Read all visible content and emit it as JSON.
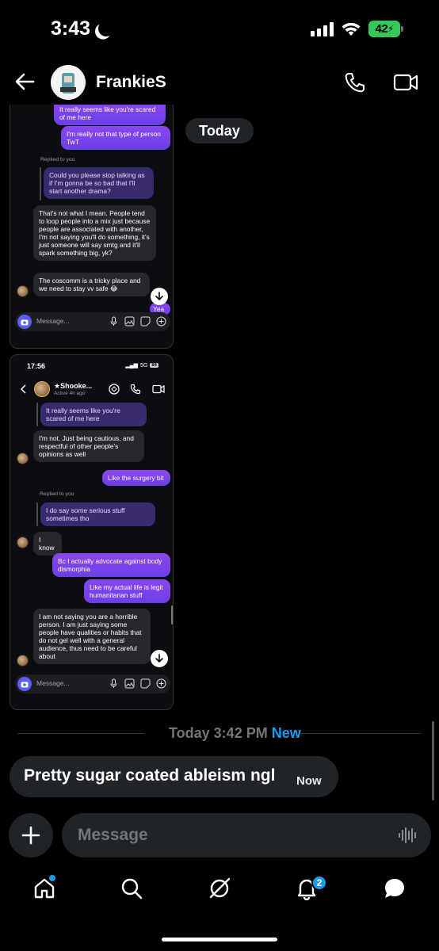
{
  "status_bar": {
    "time": "3:43",
    "battery": "42"
  },
  "header": {
    "contact_name": "FrankieS"
  },
  "today_label": "Today",
  "shot1": {
    "messages": [
      {
        "text": "It really seems like you're scared of me here"
      },
      {
        "text": "I'm really not that type of person TwT"
      },
      {
        "text": "Replied to you"
      },
      {
        "text": "Could you please stop talking as if I'm gonna be so bad that I'll start another drama?"
      },
      {
        "text": "That's not what I mean. People tend to loop people into a mix just because people are associated with another, I'm not saying you'll do something, it's just someone will say smtg and it'll spark something big, yk?"
      },
      {
        "text": "The coscomm is a tricky place and we need to stay vv safe 😂"
      },
      {
        "text": "Yea"
      }
    ],
    "composer_placeholder": "Message..."
  },
  "shot2": {
    "status_time": "17:56",
    "network": "5G",
    "battery": "84",
    "header_name": "Shooke...",
    "header_active": "Active 4h ago",
    "messages": [
      {
        "text": "It really seems like you're scared of me here"
      },
      {
        "text": "I'm not. Just being cautious, and respectful of other people's opinions as well"
      },
      {
        "text": "Like the surgery bit"
      },
      {
        "text": "Replied to you"
      },
      {
        "text": "I do say some serious stuff sometimes tho"
      },
      {
        "text": "I know"
      },
      {
        "text": "Bc I actually advocate against body dismorphia"
      },
      {
        "text": "Like my actual life is legit humanitarian stuff"
      },
      {
        "text": "I am not saying you are a horrible person. I am just saying some people have qualities or habits that do not gel well with a general audience, thus need to be careful about"
      }
    ],
    "composer_placeholder": "Message..."
  },
  "divider": {
    "text": "Today 3:42 PM",
    "new_label": "New"
  },
  "latest_message": {
    "text": "Pretty sugar coated ableism ngl",
    "time": "Now"
  },
  "composer": {
    "placeholder": "Message"
  },
  "tabbar": {
    "notifications_badge": "2"
  },
  "colors": {
    "accent": "#1d9bf0",
    "bubble_out": "#7b3fe4",
    "bubble_in": "#26282d",
    "surface": "#202327"
  }
}
